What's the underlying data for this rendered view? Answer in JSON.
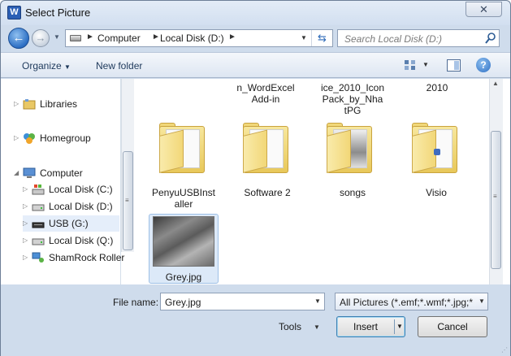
{
  "window": {
    "app_icon_letter": "W",
    "title": "Select Picture",
    "close_glyph": "✕"
  },
  "nav_bar": {
    "back_glyph": "←",
    "forward_glyph": "→",
    "breadcrumbs": [
      "Computer",
      "Local Disk (D:)"
    ],
    "search_placeholder": "Search Local Disk (D:)"
  },
  "toolbar": {
    "organize_label": "Organize",
    "new_folder_label": "New folder",
    "help_glyph": "?"
  },
  "sidebar": {
    "items": [
      {
        "label": "Libraries",
        "icon": "libraries-icon"
      },
      {
        "label": "Homegroup",
        "icon": "homegroup-icon"
      },
      {
        "label": "Computer",
        "icon": "computer-icon"
      },
      {
        "label": "Local Disk (C:)",
        "icon": "windows-drive-icon"
      },
      {
        "label": "Local Disk (D:)",
        "icon": "drive-icon"
      },
      {
        "label": "USB (G:)",
        "icon": "usb-drive-icon"
      },
      {
        "label": "Local Disk (Q:)",
        "icon": "drive-icon"
      },
      {
        "label": "ShamRock Roller",
        "icon": "network-icon"
      }
    ]
  },
  "files": {
    "partial_labels": [
      "n_WordExcel\nAdd-in",
      "ice_2010_Icon\nPack_by_Nha\ntPG",
      "2010"
    ],
    "folders": [
      {
        "name": "PenyuUSBInst\naller"
      },
      {
        "name": "Software 2"
      },
      {
        "name": "songs"
      },
      {
        "name": "Visio"
      }
    ],
    "selected_file": {
      "name": "Grey.jpg"
    }
  },
  "footer": {
    "file_name_label": "File name:",
    "file_name_value": "Grey.jpg",
    "file_type_value": "All Pictures (*.emf;*.wmf;*.jpg;*",
    "tools_label": "Tools",
    "insert_label": "Insert",
    "cancel_label": "Cancel"
  }
}
